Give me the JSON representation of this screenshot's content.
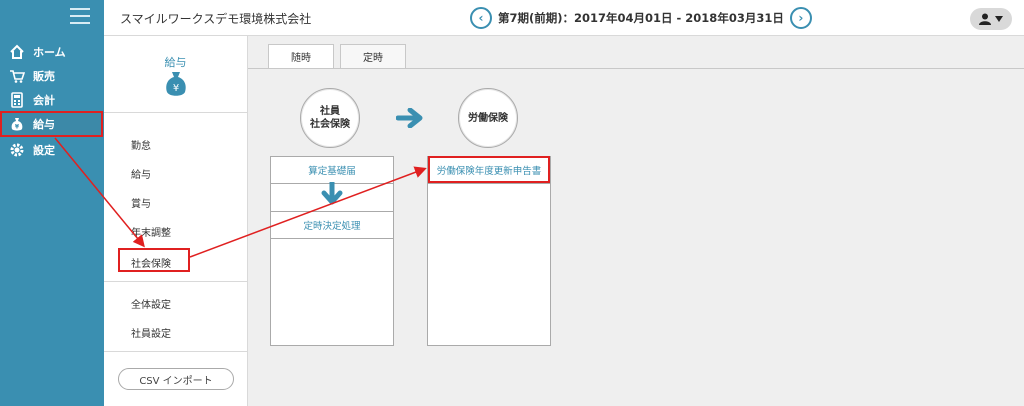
{
  "nav": {
    "items": [
      {
        "label": "ホーム",
        "icon": "home-icon"
      },
      {
        "label": "販売",
        "icon": "cart-icon"
      },
      {
        "label": "会計",
        "icon": "calculator-icon"
      },
      {
        "label": "給与",
        "icon": "money-bag-icon"
      },
      {
        "label": "設定",
        "icon": "gear-icon"
      }
    ]
  },
  "header": {
    "company": "スマイルワークスデモ環境株式会社",
    "period": "第7期(前期)：2017年04月01日 - 2018年03月31日"
  },
  "submenu": {
    "title": "給与",
    "items": [
      "勤怠",
      "給与",
      "賞与",
      "年末調整",
      "社会保険"
    ],
    "items2": [
      "全体設定",
      "社員設定"
    ],
    "csv_label": "CSV インポート"
  },
  "main": {
    "tabs": [
      "随時",
      "定時"
    ],
    "node1": "社員\n社会保険",
    "node2": "労働保険",
    "box1": [
      "算定基礎届",
      "定時決定処理"
    ],
    "box2": [
      "労働保険年度更新申告書"
    ]
  },
  "colors": {
    "nav_bg": "#3a8fb1",
    "accent": "#3a8fb1",
    "highlight": "#e02020"
  }
}
